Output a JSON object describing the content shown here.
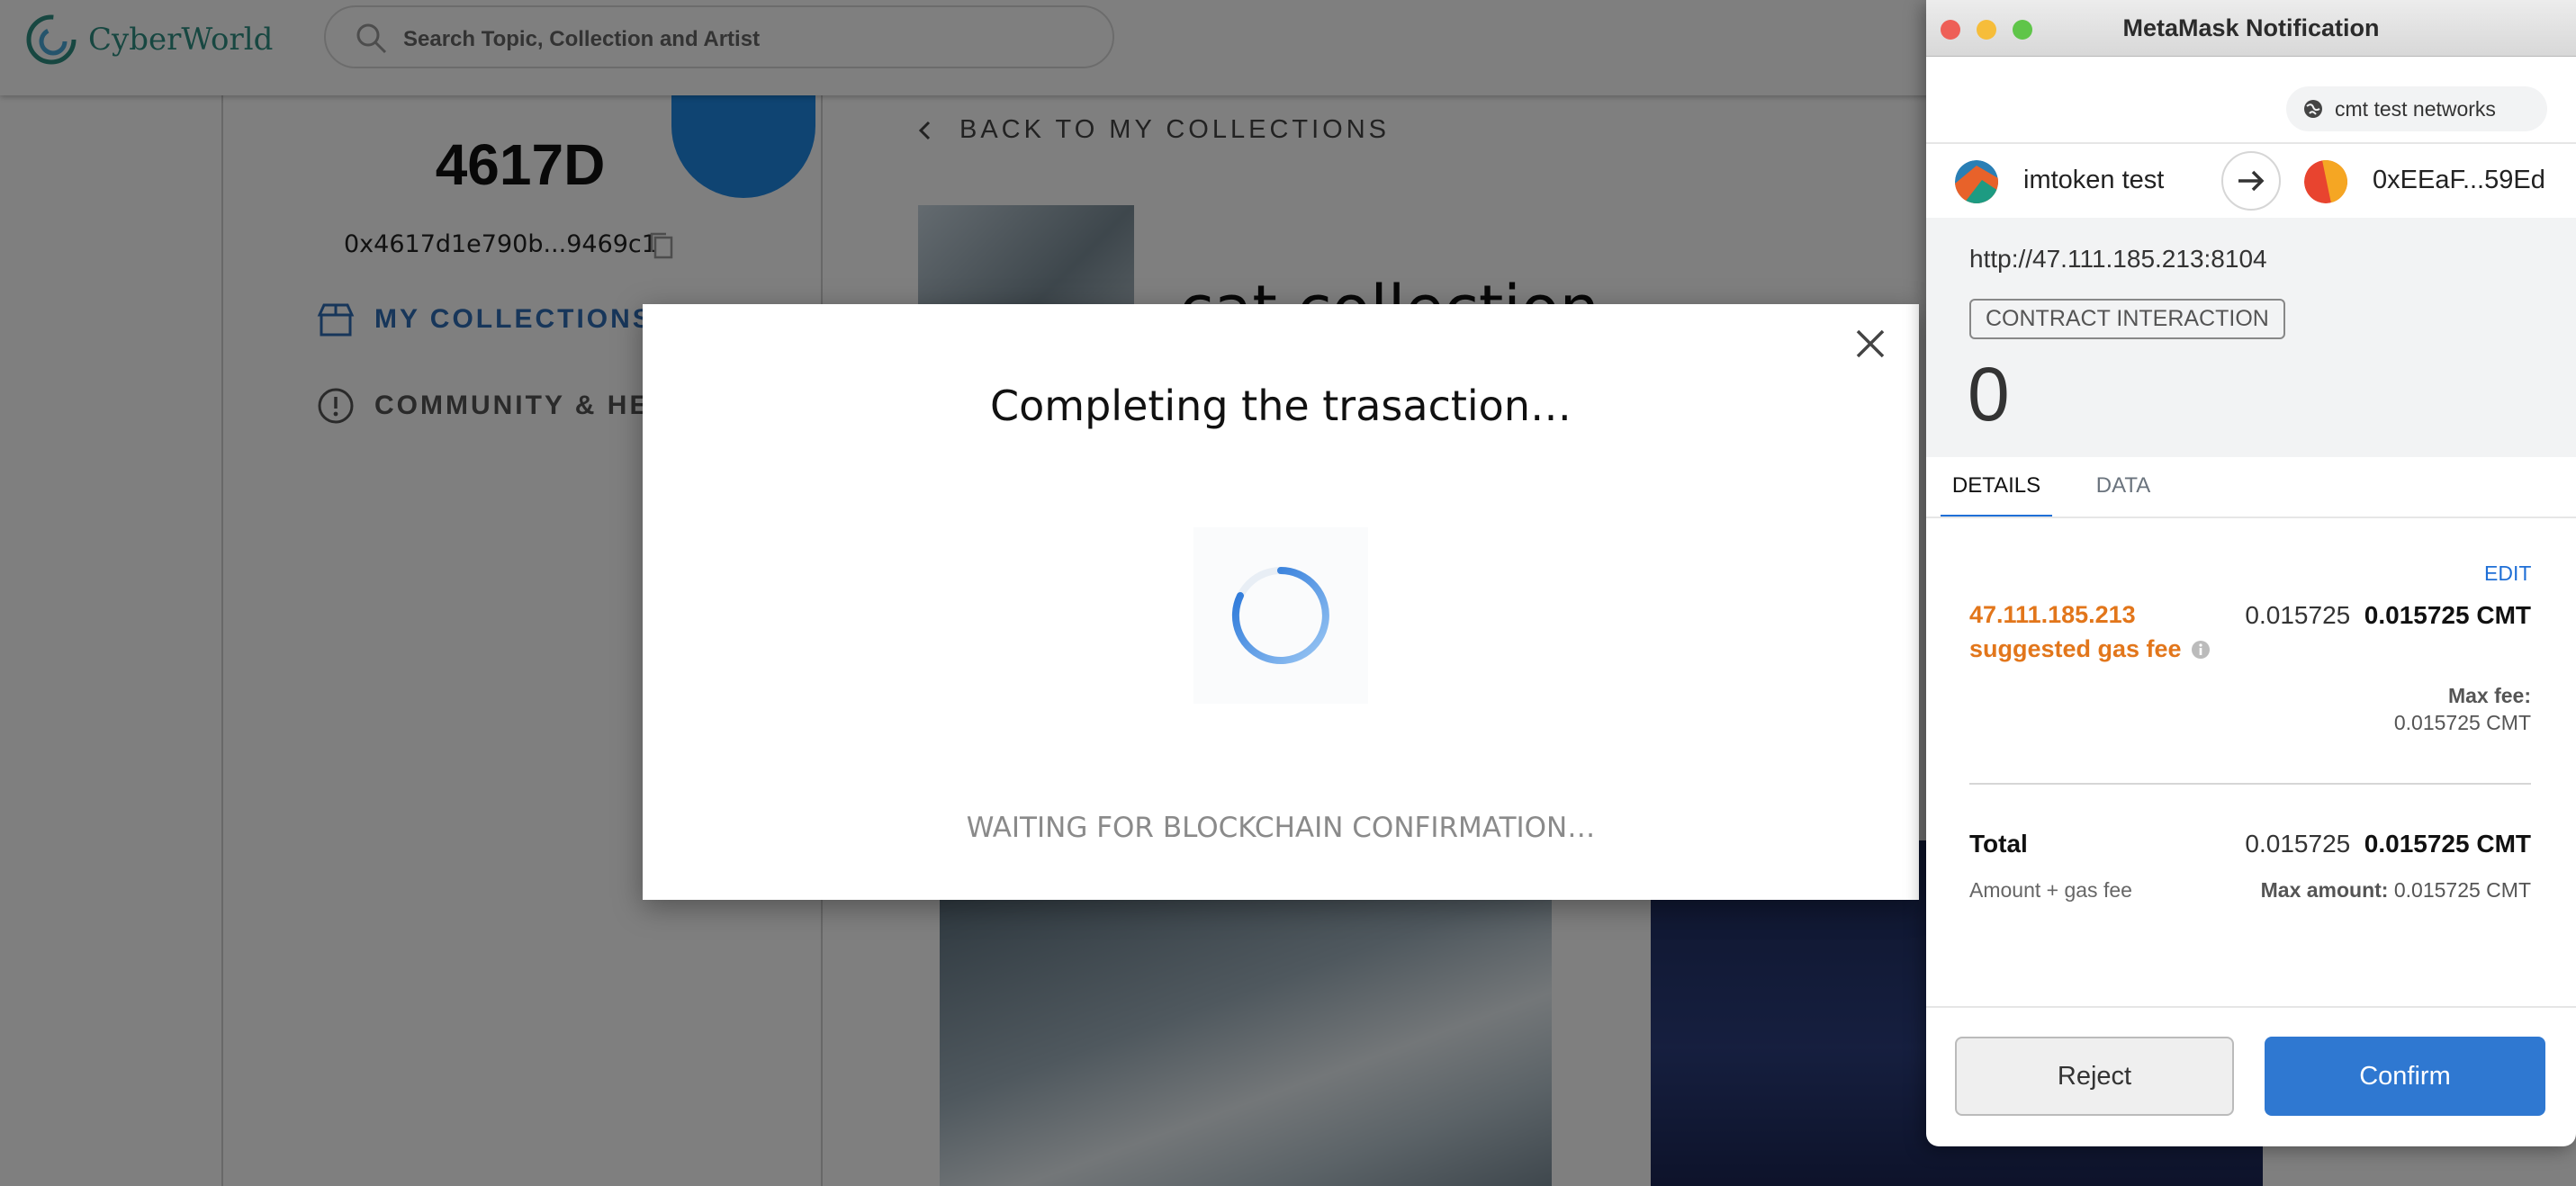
{
  "app": {
    "brand": "CyberWorld",
    "search": {
      "placeholder": "Search Topic, Collection and Artist"
    }
  },
  "profile": {
    "name": "4617D",
    "address": "0x4617d1e790b...9469c1"
  },
  "sidebar": {
    "items": [
      {
        "label": "MY COLLECTIONS",
        "active": true
      },
      {
        "label": "COMMUNITY & HELP",
        "active": false
      }
    ]
  },
  "main": {
    "back_label": "BACK TO MY COLLECTIONS",
    "collection_title": "cat collection"
  },
  "modal": {
    "title": "Completing the trasaction…",
    "status": "WAITING FOR BLOCKCHAIN CONFIRMATION…"
  },
  "metamask": {
    "window_title": "MetaMask Notification",
    "network": "cmt test networks",
    "from_account": "imtoken test",
    "to_account": "0xEEaF...59Ed",
    "origin": "http://47.111.185.213:8104",
    "badge": "CONTRACT INTERACTION",
    "amount": "0",
    "tabs": [
      "DETAILS",
      "DATA"
    ],
    "edit_label": "EDIT",
    "fee": {
      "origin": "47.111.185.213",
      "label": "suggested gas fee",
      "value_plain": "0.015725",
      "value_bold": "0.015725 CMT",
      "max_fee_label": "Max fee:",
      "max_fee_value": "0.015725 CMT"
    },
    "total": {
      "label": "Total",
      "sub_label": "Amount + gas fee",
      "value_plain": "0.015725",
      "value_bold": "0.015725 CMT",
      "max_amount_label": "Max amount:",
      "max_amount_value": "0.015725 CMT"
    },
    "buttons": {
      "reject": "Reject",
      "confirm": "Confirm"
    }
  },
  "colors": {
    "accent_blue": "#2f78d1",
    "fee_orange": "#e2761b",
    "brand_teal": "#2f8f83",
    "sidebar_active": "#2e6db4"
  }
}
